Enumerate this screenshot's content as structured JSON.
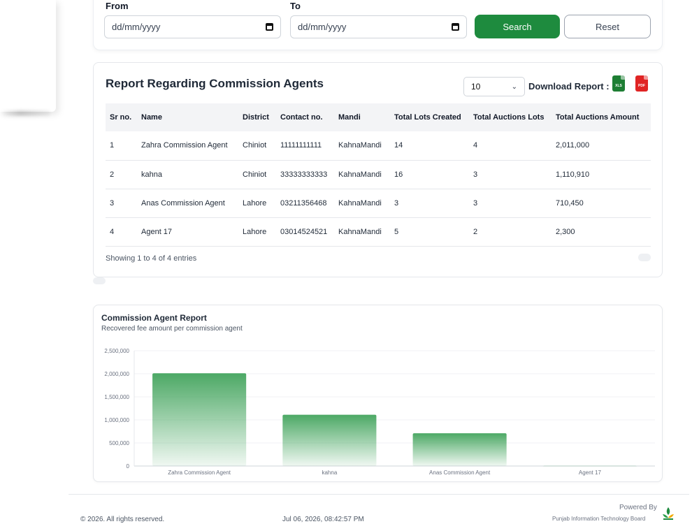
{
  "filters": {
    "from_label": "From",
    "to_label": "To",
    "from_placeholder": "dd/mm/yyyy",
    "to_placeholder": "dd/mm/yyyy",
    "search_label": "Search",
    "reset_label": "Reset"
  },
  "report": {
    "title": "Report Regarding Commission Agents",
    "page_size": "10",
    "download_label": "Download Report :",
    "xls_label": "XLS",
    "pdf_label": "PDF",
    "columns": [
      "Sr no.",
      "Name",
      "District",
      "Contact no.",
      "Mandi",
      "Total Lots Created",
      "Total Auctions Lots",
      "Total Auctions Amount"
    ],
    "rows": [
      [
        "1",
        "Zahra Commission Agent",
        "Chiniot",
        "11111111111",
        "KahnaMandi",
        "14",
        "4",
        "2,011,000"
      ],
      [
        "2",
        "kahna",
        "Chiniot",
        "33333333333",
        "KahnaMandi",
        "16",
        "3",
        "1,110,910"
      ],
      [
        "3",
        "Anas Commission Agent",
        "Lahore",
        "03211356468",
        "KahnaMandi",
        "3",
        "3",
        "710,450"
      ],
      [
        "4",
        "Agent 17",
        "Lahore",
        "03014524521",
        "KahnaMandi",
        "5",
        "2",
        "2,300"
      ]
    ],
    "showing": "Showing 1 to 4 of 4 entries"
  },
  "chart_data": {
    "type": "bar",
    "title": "Commission Agent Report",
    "subtitle": "Recovered fee amount per commission agent",
    "categories": [
      "Zahra Commission Agent",
      "kahna",
      "Anas Commission Agent",
      "Agent 17"
    ],
    "values": [
      2011000,
      1110910,
      710450,
      2300
    ],
    "ylim": [
      0,
      2500000
    ],
    "yticks": [
      0,
      500000,
      1000000,
      1500000,
      2000000,
      2500000
    ],
    "ytick_labels": [
      "0",
      "500,000",
      "1,000,000",
      "1,500,000",
      "2,000,000",
      "2,500,000"
    ],
    "grid": true,
    "bar_color": "#1e8b3e"
  },
  "footer": {
    "copyright": "© 2026. All rights reserved.",
    "datetime": "Jul 06, 2026, 08:42:57 PM",
    "powered_by": "Powered By",
    "org": "Punjab Information Technology Board"
  }
}
